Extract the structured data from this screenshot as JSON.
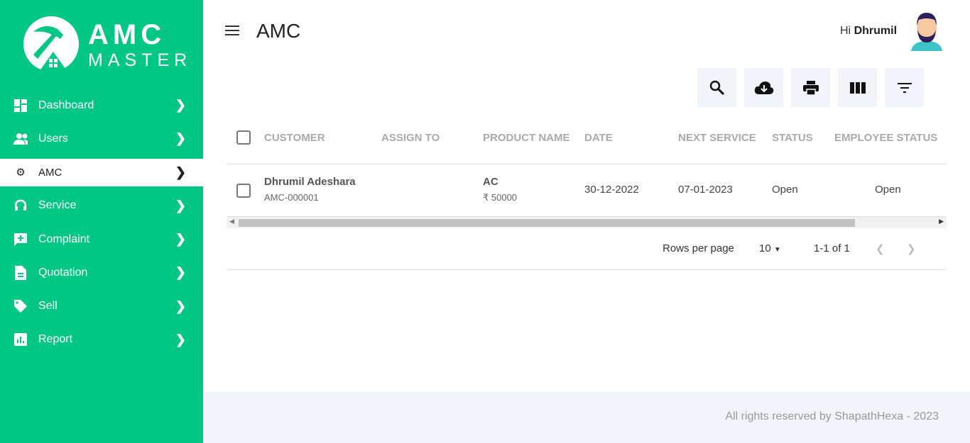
{
  "brand": {
    "line1": "AMC",
    "line2": "MASTER"
  },
  "sidebar": {
    "items": [
      {
        "label": "Dashboard",
        "icon": "dashboard-icon"
      },
      {
        "label": "Users",
        "icon": "users-icon"
      },
      {
        "label": "AMC",
        "icon": "gears-icon",
        "active": true
      },
      {
        "label": "Service",
        "icon": "headset-icon"
      },
      {
        "label": "Complaint",
        "icon": "complaint-icon"
      },
      {
        "label": "Quotation",
        "icon": "document-icon"
      },
      {
        "label": "Sell",
        "icon": "tag-icon"
      },
      {
        "label": "Report",
        "icon": "report-icon"
      }
    ]
  },
  "header": {
    "title": "AMC",
    "greeting": "Hi",
    "user": "Dhrumil"
  },
  "table": {
    "columns": [
      "CUSTOMER",
      "ASSIGN TO",
      "PRODUCT NAME",
      "DATE",
      "NEXT SERVICE",
      "STATUS",
      "EMPLOYEE STATUS"
    ],
    "rows": [
      {
        "customer": "Dhrumil Adeshara",
        "id": "AMC-000001",
        "assign_to": "",
        "product": "AC",
        "price": "₹ 50000",
        "date": "30-12-2022",
        "next_service": "07-01-2023",
        "status": "Open",
        "employee_status": "Open"
      }
    ]
  },
  "pagination": {
    "rows_label": "Rows per page",
    "rows_value": "10",
    "range": "1-1 of 1"
  },
  "footer": {
    "text": "All rights reserved by ShapathHexa - 2023"
  },
  "colors": {
    "brand": "#02c683"
  }
}
